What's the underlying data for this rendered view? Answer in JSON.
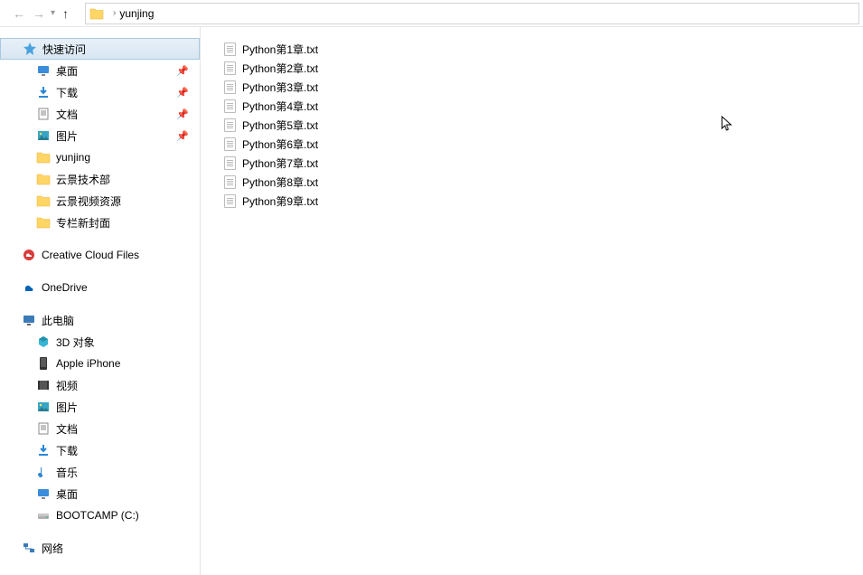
{
  "toolbar": {
    "back": "←",
    "forward": "→",
    "dropdown": "▾",
    "up": "↑"
  },
  "breadcrumb": {
    "current": "yunjing",
    "sep": "›"
  },
  "sidebar": {
    "quickAccess": "快速访问",
    "pinned": [
      {
        "label": "桌面",
        "icon": "desktop"
      },
      {
        "label": "下载",
        "icon": "download"
      },
      {
        "label": "文档",
        "icon": "document"
      },
      {
        "label": "图片",
        "icon": "picture"
      }
    ],
    "recentFolders": [
      {
        "label": "yunjing"
      },
      {
        "label": "云景技术部"
      },
      {
        "label": "云景视频资源"
      },
      {
        "label": "专栏新封面"
      }
    ],
    "creativeCloud": "Creative Cloud Files",
    "oneDrive": "OneDrive",
    "thisPC": {
      "label": "此电脑",
      "items": [
        {
          "label": "3D 对象",
          "icon": "3d"
        },
        {
          "label": "Apple iPhone",
          "icon": "phone"
        },
        {
          "label": "视频",
          "icon": "video"
        },
        {
          "label": "图片",
          "icon": "picture"
        },
        {
          "label": "文档",
          "icon": "document"
        },
        {
          "label": "下载",
          "icon": "download"
        },
        {
          "label": "音乐",
          "icon": "music"
        },
        {
          "label": "桌面",
          "icon": "desktop"
        },
        {
          "label": "BOOTCAMP (C:)",
          "icon": "drive"
        }
      ]
    },
    "network": "网络"
  },
  "files": [
    {
      "name": "Python第1章.txt"
    },
    {
      "name": "Python第2章.txt"
    },
    {
      "name": "Python第3章.txt"
    },
    {
      "name": "Python第4章.txt"
    },
    {
      "name": "Python第5章.txt"
    },
    {
      "name": "Python第6章.txt"
    },
    {
      "name": "Python第7章.txt"
    },
    {
      "name": "Python第8章.txt"
    },
    {
      "name": "Python第9章.txt"
    }
  ]
}
